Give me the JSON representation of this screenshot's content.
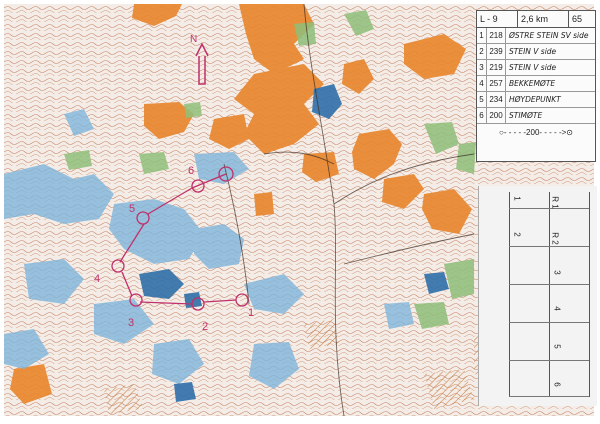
{
  "legend": {
    "course": "L - 9",
    "length": "2,6 km",
    "climb": "65",
    "controls": [
      {
        "num": "1",
        "code": "218",
        "desc": "ØSTRE STEIN SV side"
      },
      {
        "num": "2",
        "code": "239",
        "desc": "STEIN V side"
      },
      {
        "num": "3",
        "code": "219",
        "desc": "STEIN V side"
      },
      {
        "num": "4",
        "code": "257",
        "desc": "BEKKEMØTE"
      },
      {
        "num": "5",
        "code": "234",
        "desc": "HØYDEPUNKT"
      },
      {
        "num": "6",
        "code": "200",
        "desc": "STIMØTE"
      }
    ],
    "finish": "○- - - - -200- - - - ->⊙"
  },
  "card": {
    "r1": "R 1",
    "r2": "R 2",
    "boxes": [
      "1",
      "2",
      "3",
      "4",
      "5",
      "6"
    ]
  },
  "map": {
    "north_letter": "N",
    "control_labels": [
      "1",
      "2",
      "3",
      "4",
      "5",
      "6"
    ],
    "colors": {
      "open": "#e8872e",
      "water": "#7fb6dc",
      "green": "#8fbf7a",
      "contour": "#b06a4a",
      "course": "#c0306a"
    }
  }
}
